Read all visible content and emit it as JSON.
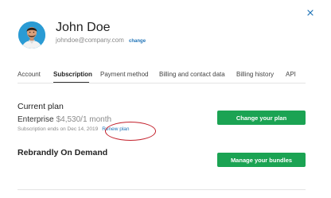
{
  "profile": {
    "name": "John Doe",
    "email": "johndoe@company.com",
    "change_label": "change"
  },
  "tabs": [
    {
      "label": "Account"
    },
    {
      "label": "Subscription",
      "active": true
    },
    {
      "label": "Payment method"
    },
    {
      "label": "Billing and contact data"
    },
    {
      "label": "Billing history"
    },
    {
      "label": "API"
    }
  ],
  "current_plan": {
    "heading": "Current plan",
    "plan_name": "Enterprise",
    "price": "$4,530/1 month",
    "ends_text": "Subscription ends on Dec 14, 2019",
    "renew_label": "Renew plan",
    "change_button": "Change your plan"
  },
  "on_demand": {
    "heading": "Rebrandly On Demand",
    "manage_button": "Manage your bundles"
  },
  "colors": {
    "accent_green": "#1ba353",
    "link_blue": "#1f73b7",
    "annotation_red": "#c3202b"
  },
  "icons": {
    "close": "close-icon"
  }
}
